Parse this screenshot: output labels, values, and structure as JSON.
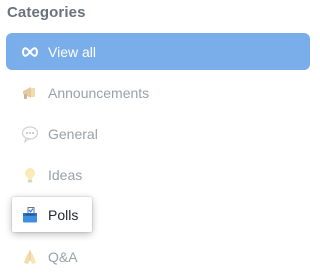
{
  "section": {
    "title": "Categories"
  },
  "categories": [
    {
      "label": "View all",
      "icon": "infinity-icon",
      "state": "selected"
    },
    {
      "label": "Announcements",
      "icon": "megaphone-icon",
      "state": "normal"
    },
    {
      "label": "General",
      "icon": "speech-bubble-icon",
      "state": "normal"
    },
    {
      "label": "Ideas",
      "icon": "lightbulb-icon",
      "state": "normal"
    },
    {
      "label": "Polls",
      "icon": "ballot-box-icon",
      "state": "focused"
    },
    {
      "label": "Q&A",
      "icon": "folded-hands-icon",
      "state": "normal"
    }
  ],
  "colors": {
    "selected_bg": "#7aaeea",
    "heading": "#6a737d",
    "muted_text": "#9aa1a8",
    "focused_text": "#24292e"
  }
}
